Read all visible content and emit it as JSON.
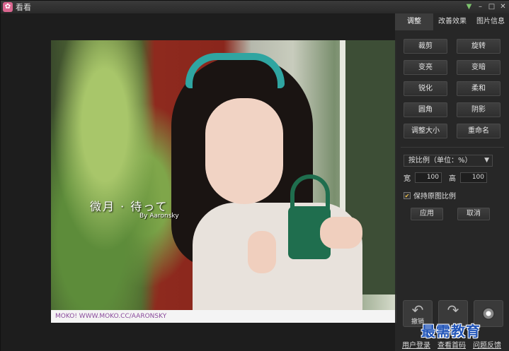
{
  "window": {
    "title": "看看"
  },
  "tabs": [
    {
      "label": "调整",
      "active": true
    },
    {
      "label": "改善效果",
      "active": false
    },
    {
      "label": "图片信息",
      "active": false
    }
  ],
  "tools": [
    {
      "label": "裁剪"
    },
    {
      "label": "旋转"
    },
    {
      "label": "变亮"
    },
    {
      "label": "变暗"
    },
    {
      "label": "锐化"
    },
    {
      "label": "柔和"
    },
    {
      "label": "圆角"
    },
    {
      "label": "阴影"
    },
    {
      "label": "调整大小"
    },
    {
      "label": "重命名"
    }
  ],
  "resize": {
    "mode": "按比例（单位：%）",
    "width_label": "宽",
    "width_value": "100",
    "height_label": "高",
    "height_value": "100",
    "keep_ratio_label": "保持原图比例",
    "keep_ratio_checked": true,
    "apply_label": "应用",
    "cancel_label": "取消"
  },
  "photo": {
    "caption": "微月 · 待って",
    "byline": "By Aaronsky",
    "footer": "MOKO! WWW.MOKO.CC/AARONSKY"
  },
  "bottom": {
    "undo_label": "撤销",
    "links": [
      "用户登录",
      "查看首码",
      "问题反馈"
    ]
  },
  "watermark": "最需教育",
  "colors": {
    "accent_watermark": "#2255b8",
    "tab_active": "#3c3c3c",
    "app_icon": "#d9668f"
  }
}
